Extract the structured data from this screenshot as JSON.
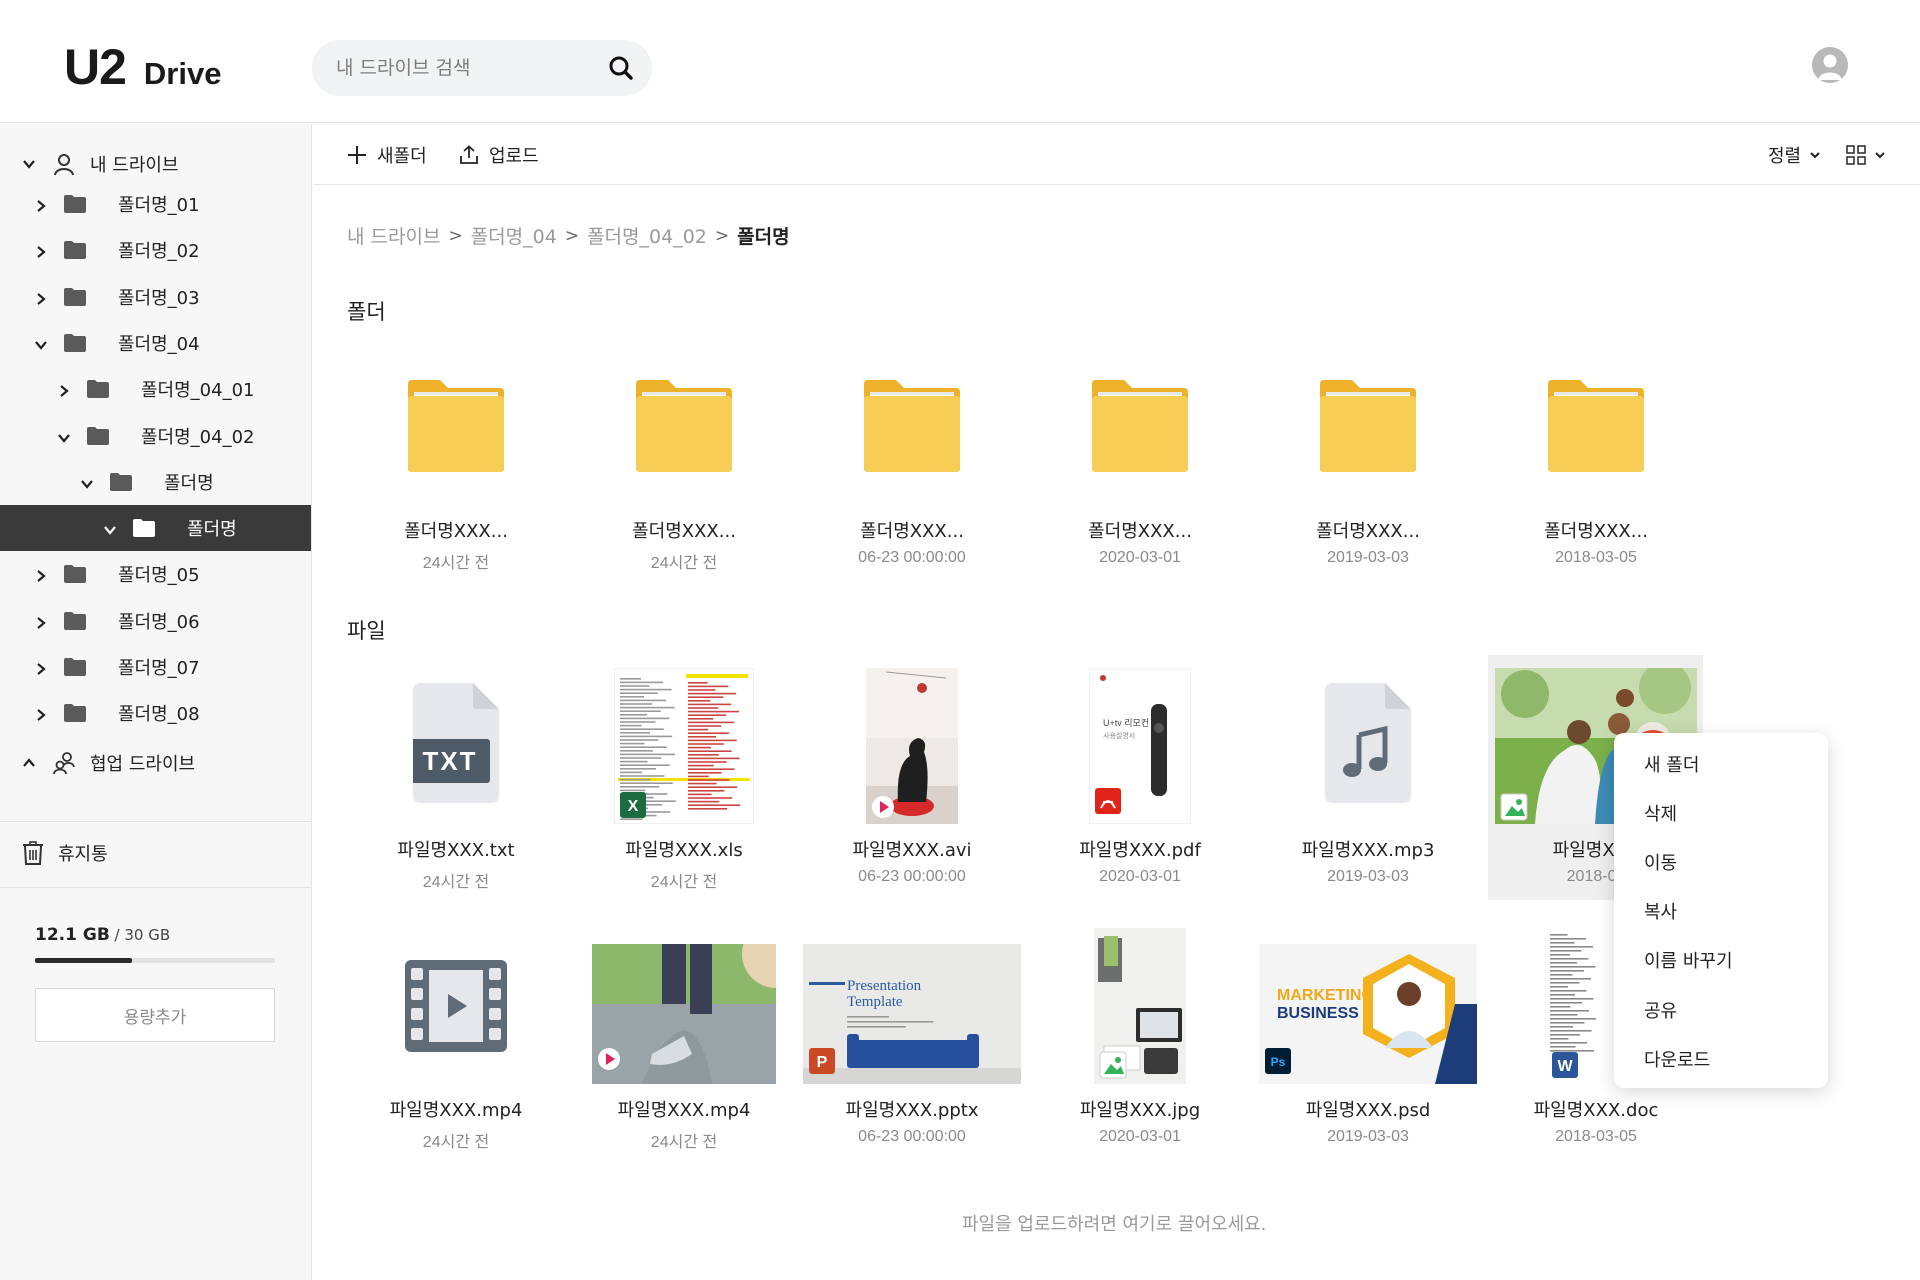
{
  "header": {
    "logo_mark": "U2",
    "logo_text": "Drive",
    "search_placeholder": "내 드라이브 검색"
  },
  "sidebar": {
    "my_drive": "내 드라이브",
    "tree": [
      {
        "label": "폴더명_01",
        "expanded": false,
        "selected": false
      },
      {
        "label": "폴더명_02",
        "expanded": false,
        "selected": false
      },
      {
        "label": "폴더명_03",
        "expanded": false,
        "selected": false
      },
      {
        "label": "폴더명_04",
        "expanded": true,
        "selected": false
      },
      {
        "label": "폴더명_04_01",
        "expanded": false,
        "selected": false
      },
      {
        "label": "폴더명_04_02",
        "expanded": true,
        "selected": false
      },
      {
        "label": "폴더명",
        "expanded": true,
        "selected": false
      },
      {
        "label": "폴더명",
        "expanded": true,
        "selected": true
      },
      {
        "label": "폴더명_05",
        "expanded": false,
        "selected": false
      },
      {
        "label": "폴더명_06",
        "expanded": false,
        "selected": false
      },
      {
        "label": "폴더명_07",
        "expanded": false,
        "selected": false
      },
      {
        "label": "폴더명_08",
        "expanded": false,
        "selected": false
      }
    ],
    "shared_drive": "협업 드라이브",
    "trash": "휴지통",
    "storage_used": "12.1 GB",
    "storage_total": " / 30 GB",
    "storage_fraction": 0.403,
    "add_storage": "용량추가"
  },
  "toolbar": {
    "new_folder": "새폴더",
    "upload": "업로드",
    "sort": "정렬"
  },
  "breadcrumb": [
    "내 드라이브",
    "폴더명_04",
    "폴더명_04_02",
    "폴더명"
  ],
  "sections": {
    "folders": "폴더",
    "files": "파일"
  },
  "folders": [
    {
      "name": "폴더명XXX...",
      "date": "24시간 전"
    },
    {
      "name": "폴더명XXX...",
      "date": "24시간 전"
    },
    {
      "name": "폴더명XXX...",
      "date": "06-23 00:00:00"
    },
    {
      "name": "폴더명XXX...",
      "date": "2020-03-01"
    },
    {
      "name": "폴더명XXX...",
      "date": "2019-03-03"
    },
    {
      "name": "폴더명XXX...",
      "date": "2018-03-05"
    }
  ],
  "files": [
    {
      "name": "파일명XXX.txt",
      "date": "24시간 전",
      "type": "txt"
    },
    {
      "name": "파일명XXX.xls",
      "date": "24시간 전",
      "type": "xls"
    },
    {
      "name": "파일명XXX.avi",
      "date": "06-23 00:00:00",
      "type": "avi"
    },
    {
      "name": "파일명XXX.pdf",
      "date": "2020-03-01",
      "type": "pdf"
    },
    {
      "name": "파일명XXX.mp3",
      "date": "2019-03-03",
      "type": "mp3"
    },
    {
      "name": "파일명XXX",
      "date": "2018-03",
      "type": "image"
    },
    {
      "name": "파일명XXX.mp4",
      "date": "24시간 전",
      "type": "mp4"
    },
    {
      "name": "파일명XXX.mp4",
      "date": "24시간 전",
      "type": "mp4-thumb"
    },
    {
      "name": "파일명XXX.pptx",
      "date": "06-23 00:00:00",
      "type": "pptx"
    },
    {
      "name": "파일명XXX.jpg",
      "date": "2020-03-01",
      "type": "jpg"
    },
    {
      "name": "파일명XXX.psd",
      "date": "2019-03-03",
      "type": "psd"
    },
    {
      "name": "파일명XXX.doc",
      "date": "2018-03-05",
      "type": "doc"
    }
  ],
  "thumb_text": {
    "txt_badge": "TXT",
    "pptx_title_1": "Presentation",
    "pptx_title_2": "Template",
    "psd_line_1": "MARKETING",
    "psd_line_2": "BUSINESS",
    "pdf_title": "U+tv 리모컨",
    "pdf_subtitle": "사용설명서"
  },
  "context_menu": [
    "새 폴더",
    "삭제",
    "이동",
    "복사",
    "이름 바꾸기",
    "공유",
    "다운로드"
  ],
  "drop_hint": "파일을 업로드하려면 여기로 끌어오세요.",
  "colors": {
    "folder": "#f7c948",
    "folder_dark": "#eeb22a",
    "selected_row": "#3a3a3a",
    "file_icon_gray": "#e5e7ea"
  }
}
